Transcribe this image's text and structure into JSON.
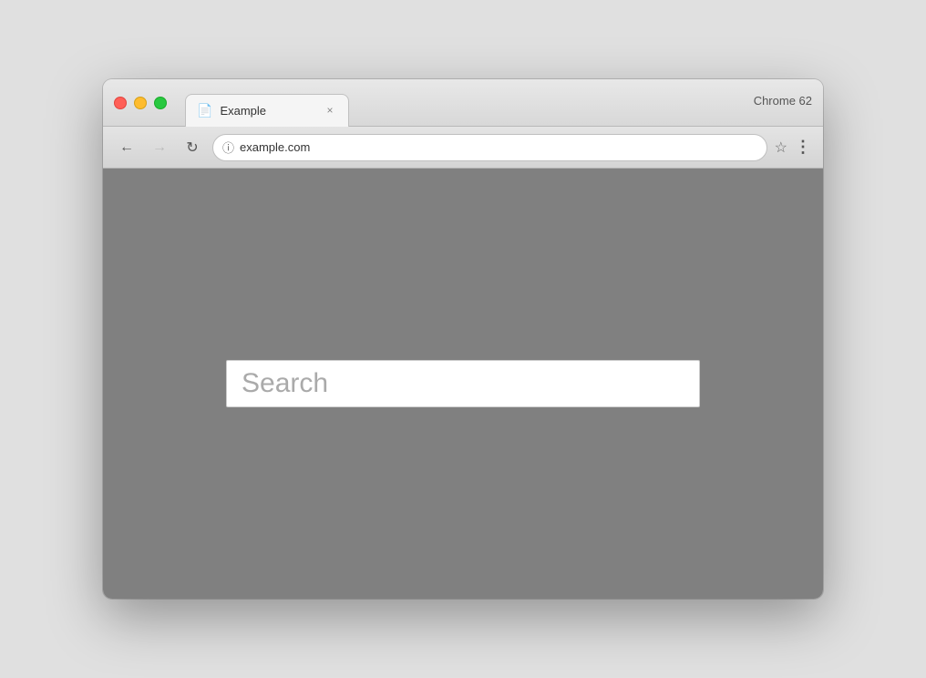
{
  "browser": {
    "chrome_label": "Chrome 62",
    "traffic_lights": {
      "close_label": "close",
      "minimize_label": "minimize",
      "maximize_label": "maximize"
    },
    "tab": {
      "icon": "📄",
      "title": "Example",
      "close": "×"
    },
    "toolbar": {
      "back_label": "←",
      "forward_label": "→",
      "reload_label": "↻",
      "security_icon": "ⓘ",
      "address": "example.com",
      "bookmark_label": "☆",
      "menu_label": "⋮"
    }
  },
  "page": {
    "search_placeholder": "Search"
  }
}
